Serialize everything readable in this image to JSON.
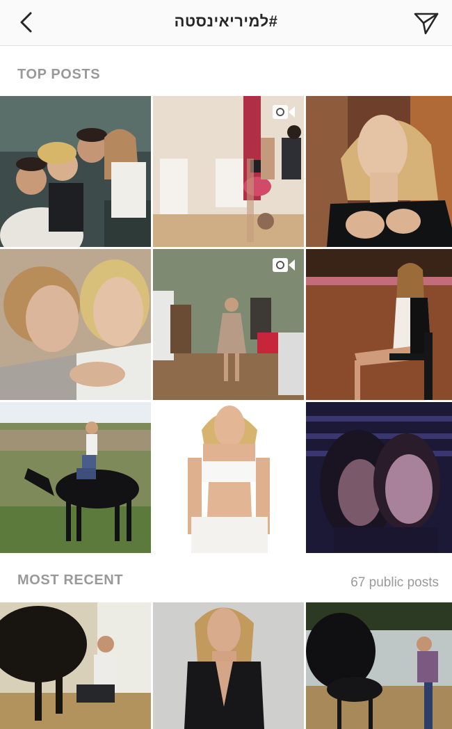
{
  "header": {
    "title": "#למיריאינסטה",
    "back_icon": "chevron-left-icon",
    "send_icon": "paper-plane-icon"
  },
  "top_posts": {
    "label": "TOP POSTS",
    "tiles": [
      {
        "name": "group-selfie-gym",
        "video": false
      },
      {
        "name": "handstand-studio",
        "video": true
      },
      {
        "name": "portrait-black-offshoulder",
        "video": false
      },
      {
        "name": "two-women-closeup-selfie",
        "video": false
      },
      {
        "name": "dressing-room-striped-dress",
        "video": true
      },
      {
        "name": "woman-seated-tv-studio",
        "video": false
      },
      {
        "name": "woman-riding-horse-field",
        "video": false
      },
      {
        "name": "white-top-studio-shoot",
        "video": false
      },
      {
        "name": "two-women-dark-selfie",
        "video": false
      }
    ]
  },
  "most_recent": {
    "label": "MOST RECENT",
    "count": "67 public posts",
    "tiles": [
      {
        "name": "woman-with-horse-stable",
        "video": false
      },
      {
        "name": "black-dress-portrait",
        "video": false
      },
      {
        "name": "horse-and-foal-stable",
        "video": false
      }
    ]
  },
  "colors": {
    "header_bg": "#fafafa",
    "section_label": "#999999",
    "divider": "#dbdbdb"
  }
}
